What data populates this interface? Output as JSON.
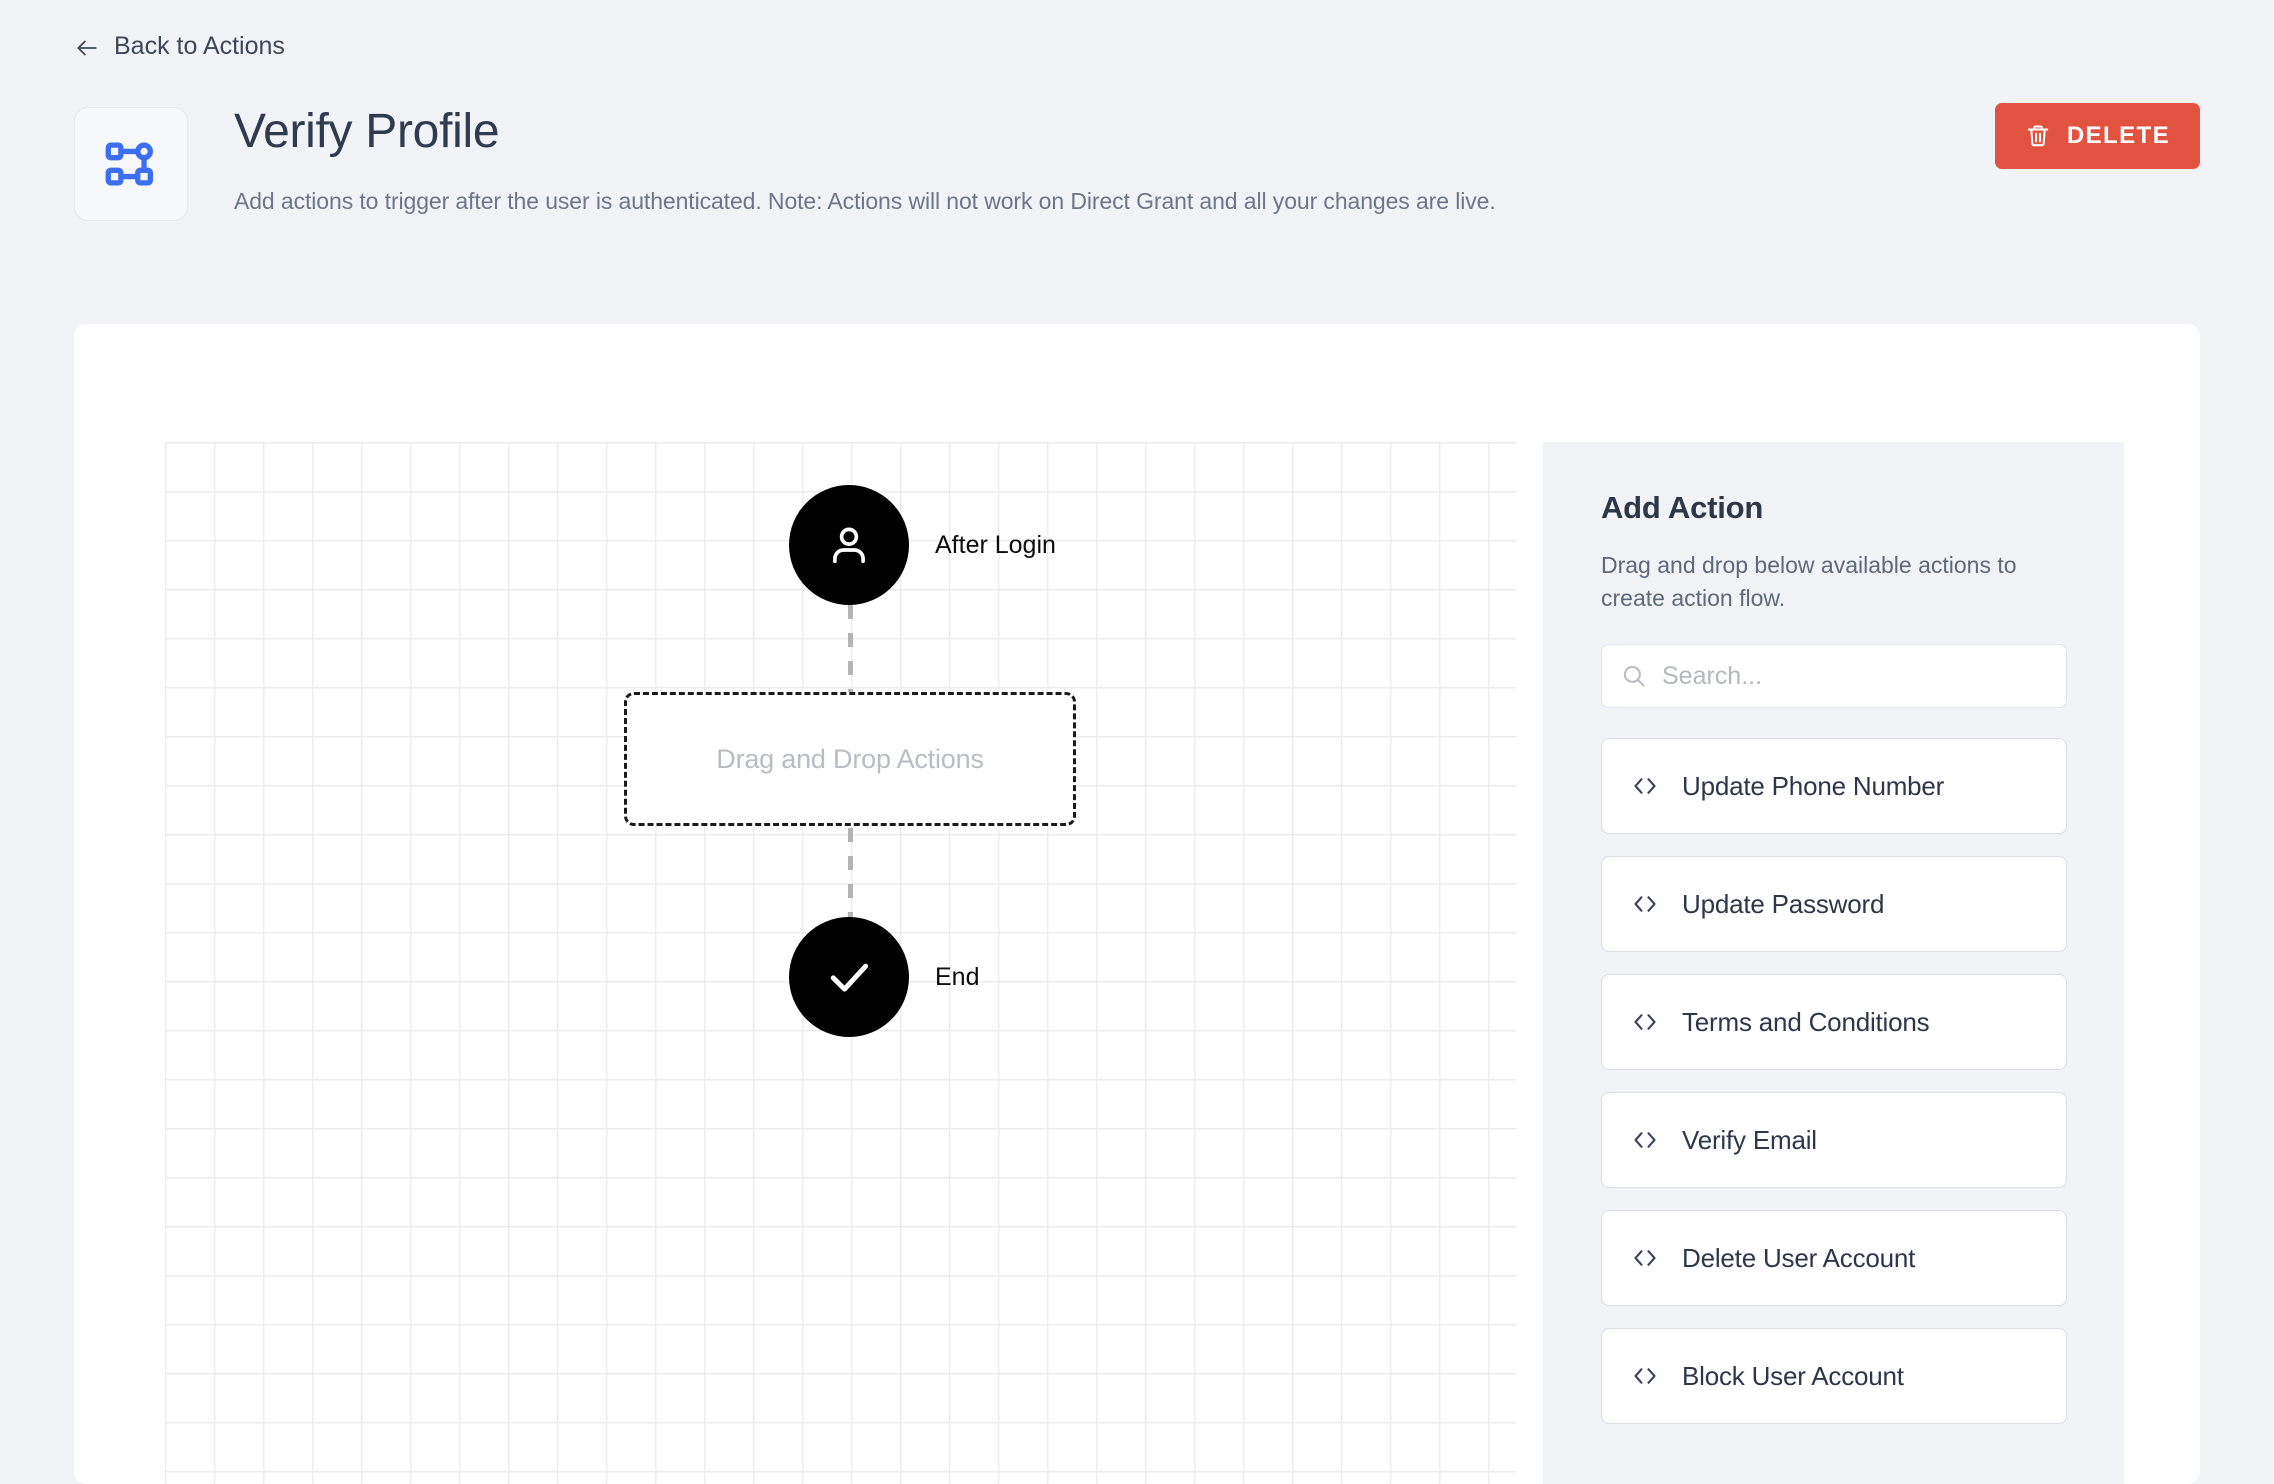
{
  "header": {
    "back_label": "Back to Actions",
    "back_icon": "arrow-left-icon",
    "title": "Verify Profile",
    "description": "Add actions to trigger after the user is authenticated. Note: Actions will not work on Direct Grant and all your changes are live.",
    "brand_icon": "flow-nodes-icon",
    "delete_label": "DELETE",
    "delete_icon": "trash-icon",
    "delete_color": "#e15241"
  },
  "flow": {
    "start_node": {
      "label": "After Login",
      "icon": "user-icon"
    },
    "dropzone": {
      "label": "Drag and Drop Actions"
    },
    "end_node": {
      "label": "End",
      "icon": "check-icon"
    }
  },
  "sidebar": {
    "title": "Add Action",
    "description": "Drag and drop below available actions to create action flow.",
    "search": {
      "placeholder": "Search...",
      "value": "",
      "icon": "search-icon"
    },
    "actions": [
      {
        "label": "Update Phone Number",
        "icon": "code-icon"
      },
      {
        "label": "Update Password",
        "icon": "code-icon"
      },
      {
        "label": "Terms and Conditions",
        "icon": "code-icon"
      },
      {
        "label": "Verify Email",
        "icon": "code-icon"
      },
      {
        "label": "Delete User Account",
        "icon": "code-icon"
      },
      {
        "label": "Block User Account",
        "icon": "code-icon"
      }
    ]
  }
}
